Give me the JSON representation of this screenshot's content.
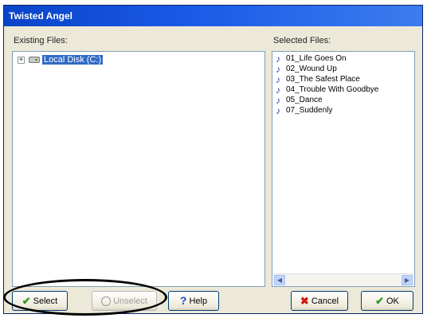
{
  "window": {
    "title": "Twisted Angel"
  },
  "left_panel": {
    "label": "Existing Files:",
    "tree": [
      {
        "label": "Local Disk (C:)",
        "expander": "+",
        "icon": "hard-disk-icon",
        "selected": true
      }
    ]
  },
  "right_panel": {
    "label": "Selected Files:",
    "files": [
      {
        "name": "01_Life Goes On",
        "icon": "music-note-icon"
      },
      {
        "name": "02_Wound Up",
        "icon": "music-note-icon"
      },
      {
        "name": "03_The Safest Place",
        "icon": "music-note-icon"
      },
      {
        "name": "04_Trouble With Goodbye",
        "icon": "music-note-icon"
      },
      {
        "name": "05_Dance",
        "icon": "music-note-icon"
      },
      {
        "name": "07_Suddenly",
        "icon": "music-note-icon"
      }
    ],
    "scroll_left": "◀",
    "scroll_right": "▶"
  },
  "buttons": {
    "select": {
      "label": "Select",
      "icon": "checkmark-icon",
      "glyph": "✔"
    },
    "unselect": {
      "label": "Unselect",
      "icon": "circle-icon",
      "disabled": true
    },
    "help": {
      "label": "Help",
      "icon": "question-icon",
      "glyph": "?"
    },
    "cancel": {
      "label": "Cancel",
      "icon": "x-icon",
      "glyph": "✖"
    },
    "ok": {
      "label": "OK",
      "icon": "checkmark-icon",
      "glyph": "✔"
    }
  },
  "colors": {
    "title_bar": "#0a44c8",
    "selection": "#316ac5",
    "note_icon": "#2a3cc8",
    "annotation_ellipse": "#000000"
  }
}
